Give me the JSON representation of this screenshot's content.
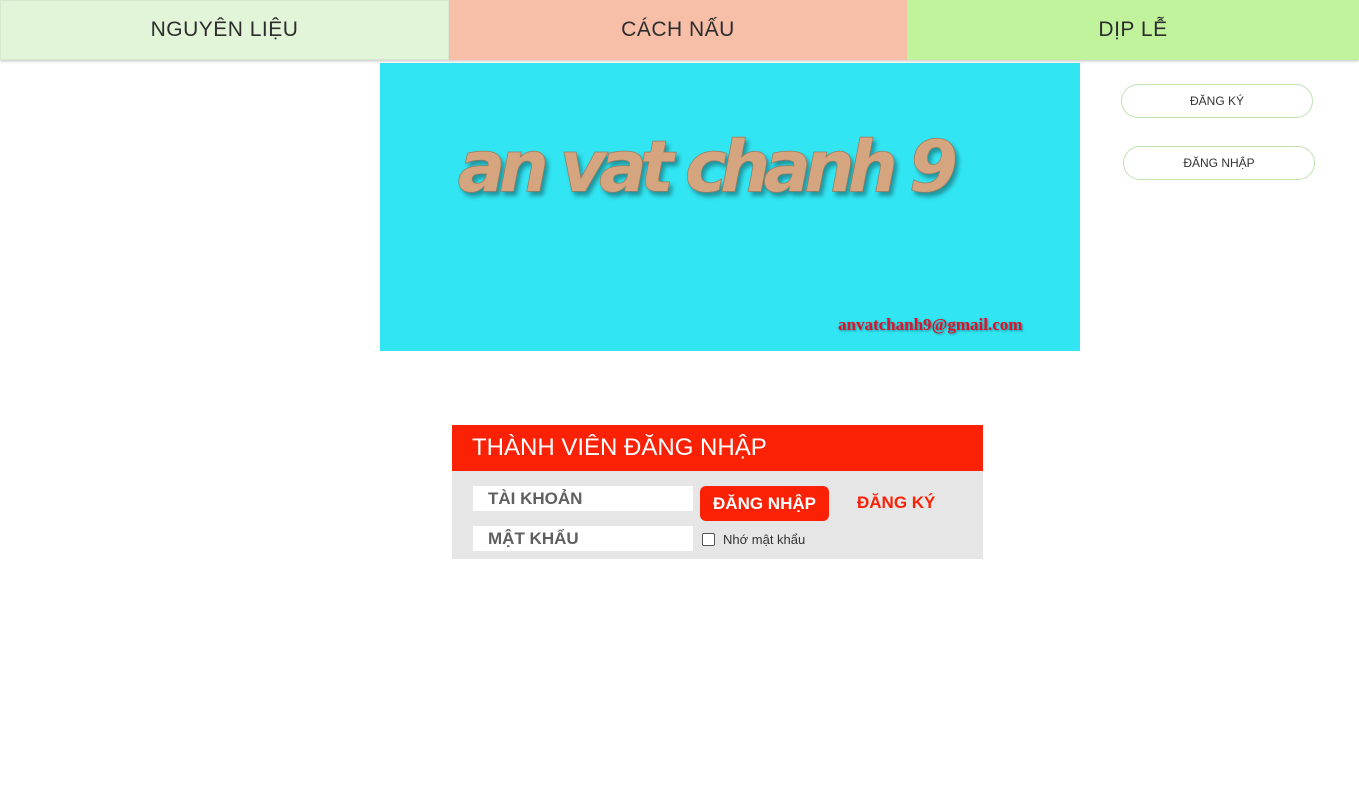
{
  "nav": {
    "items": [
      {
        "label": "NGUYÊN LIỆU",
        "color": "#e2f5d8"
      },
      {
        "label": "CÁCH NẤU",
        "color": "#f8bfa8"
      },
      {
        "label": "DỊP LỄ",
        "color": "#c1f29c"
      }
    ]
  },
  "banner": {
    "logo_text": "an vat chanh 9",
    "email": "anvatchanh9@gmail.com",
    "background": "#31e5f2"
  },
  "side": {
    "register_label": "ĐĂNG KÝ",
    "login_label": "ĐĂNG NHẬP"
  },
  "login": {
    "title": "THÀNH VIÊN ĐĂNG NHẬP",
    "username_placeholder": "TÀI KHOẢN",
    "password_placeholder": "MẬT KHẨU",
    "login_button": "ĐĂNG NHẬP",
    "register_link": "ĐĂNG KÝ",
    "remember_label": "Nhớ mật khẩu",
    "accent": "#fa2105"
  }
}
